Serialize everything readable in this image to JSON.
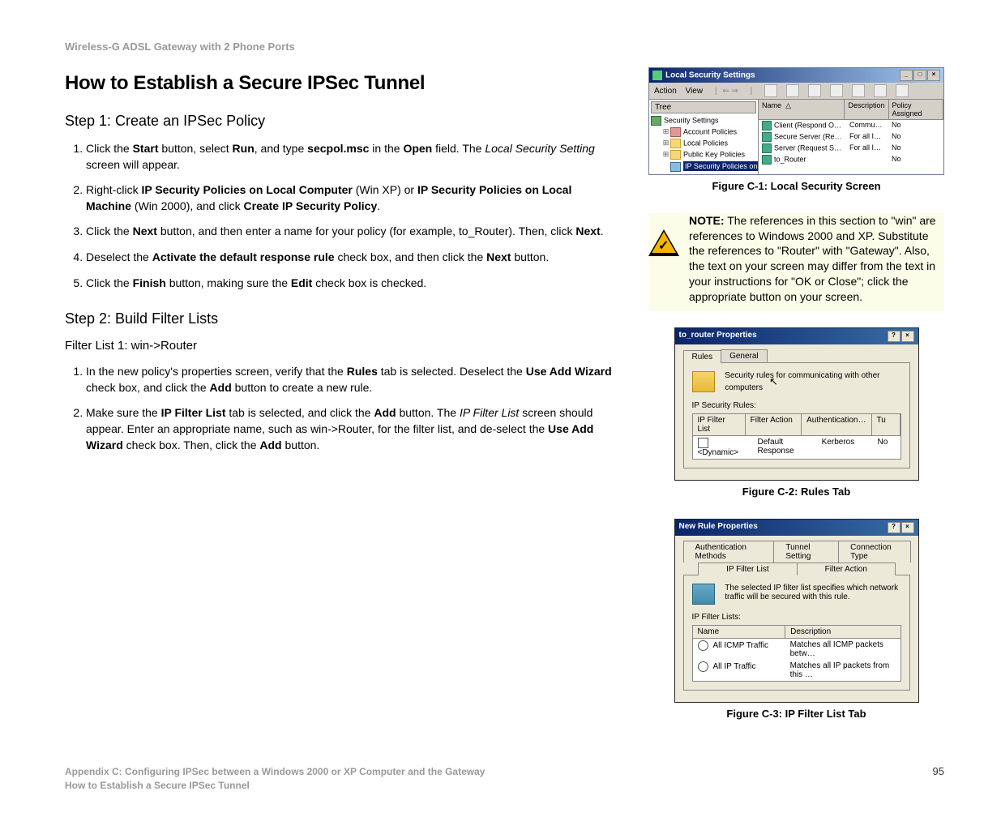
{
  "product_name": "Wireless-G ADSL Gateway with 2 Phone Ports",
  "title": "How to Establish a Secure IPSec Tunnel",
  "step1": {
    "heading": "Step 1: Create an IPSec Policy",
    "items": [
      "Click the <b>Start</b> button, select <b>Run</b>, and type <b>secpol.msc</b> in the <b>Open</b> field.  The <i>Local Security Setting</i> screen will appear.",
      "Right-click <b>IP Security Policies on Local Computer</b> (Win XP) or <b>IP Security Policies on Local Machine</b> (Win 2000), and click <b>Create IP Security Policy</b>.",
      "Click the <b>Next</b> button, and then enter a name for your policy (for example, to_Router). Then, click <b>Next</b>.",
      "Deselect the <b>Activate the default response rule</b> check box, and then click the <b>Next</b> button.",
      "Click the <b>Finish</b> button, making sure the <b>Edit</b> check box is checked."
    ]
  },
  "step2": {
    "heading": "Step 2: Build Filter Lists",
    "subheading": "Filter List 1: win->Router",
    "items": [
      "In the new policy's properties screen, verify that the <b>Rules</b> tab is selected. Deselect the <b>Use Add Wizard</b> check box, and click the <b>Add</b> button to create a new rule.",
      "Make sure the <b>IP Filter List</b> tab is selected, and click the <b>Add</b> button. The <i>IP Filter List</i> screen should appear. Enter an appropriate name, such as win->Router, for the filter list, and de-select the <b>Use Add Wizard</b> check box. Then, click the <b>Add</b> button."
    ]
  },
  "fig1": {
    "caption": "Figure C-1: Local Security Screen",
    "title": "Local Security Settings",
    "menu_action": "Action",
    "menu_view": "View",
    "tree_header": "Tree",
    "tree_root": "Security Settings",
    "tree_items": [
      "Account Policies",
      "Local Policies",
      "Public Key Policies"
    ],
    "tree_selected": "IP Security Policies on Local Machine",
    "list_headers": {
      "name": "Name",
      "desc": "Description",
      "pol": "Policy Assigned"
    },
    "rows": [
      {
        "name": "Client (Respond Only)",
        "desc": "Communicate normally (uns…",
        "pol": "No"
      },
      {
        "name": "Secure Server (Requir…",
        "desc": "For all IP traffic, always req…",
        "pol": "No"
      },
      {
        "name": "Server (Request Secu…",
        "desc": "For all IP traffic, always req…",
        "pol": "No"
      },
      {
        "name": "to_Router",
        "desc": "",
        "pol": "No"
      }
    ]
  },
  "note": {
    "label": "NOTE:",
    "text": "The references in this section to \"win\" are references to Windows 2000 and XP. Substitute the references to \"Router\" with \"Gateway\". Also, the text on your screen may differ from the text in your instructions for \"OK or Close\"; click the appropriate button on your screen."
  },
  "fig2": {
    "caption": "Figure C-2: Rules Tab",
    "title": "to_router Properties",
    "tab_rules": "Rules",
    "tab_general": "General",
    "desc": "Security rules for communicating with other computers",
    "label": "IP Security Rules:",
    "headers": {
      "a": "IP Filter List",
      "b": "Filter Action",
      "c": "Authentication…",
      "d": "Tu"
    },
    "row": {
      "a": "<Dynamic>",
      "b": "Default Response",
      "c": "Kerberos",
      "d": "No"
    }
  },
  "fig3": {
    "caption": "Figure C-3: IP Filter List Tab",
    "title": "New Rule Properties",
    "tabs_top": [
      "Authentication Methods",
      "Tunnel Setting",
      "Connection Type"
    ],
    "tabs_bottom": [
      "IP Filter List",
      "Filter Action"
    ],
    "desc": "The selected IP filter list specifies which network traffic will be secured with this rule.",
    "label": "IP Filter Lists:",
    "headers": {
      "name": "Name",
      "desc": "Description"
    },
    "rows": [
      {
        "name": "All ICMP Traffic",
        "desc": "Matches all ICMP packets betw…"
      },
      {
        "name": "All IP Traffic",
        "desc": "Matches all IP packets from this …"
      }
    ]
  },
  "footer": {
    "line1": "Appendix C: Configuring IPSec between a Windows 2000 or XP Computer and the Gateway",
    "line2": "How to Establish a Secure IPSec Tunnel",
    "page": "95"
  }
}
